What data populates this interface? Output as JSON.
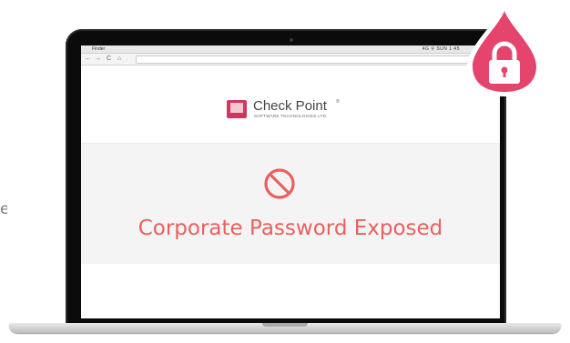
{
  "side_text": "e",
  "browser": {
    "menubar": {
      "apple": "",
      "app_name": "Finder",
      "status": "4G  ⚲  SUN 1:45"
    },
    "nav": {
      "back": "←",
      "forward": "→",
      "reload": "C",
      "home": "⌂"
    }
  },
  "logo": {
    "name": "Check Point",
    "tm": "®",
    "subtitle": "SOFTWARE TECHNOLOGIES LTD."
  },
  "alert": {
    "icon": "blocked-icon",
    "message": "Corporate Password Exposed"
  },
  "badge": {
    "icon": "lock-icon"
  },
  "colors": {
    "brand_pink": "#d4345e",
    "alert_red": "#e8615e",
    "badge_pink": "#e5446d"
  }
}
